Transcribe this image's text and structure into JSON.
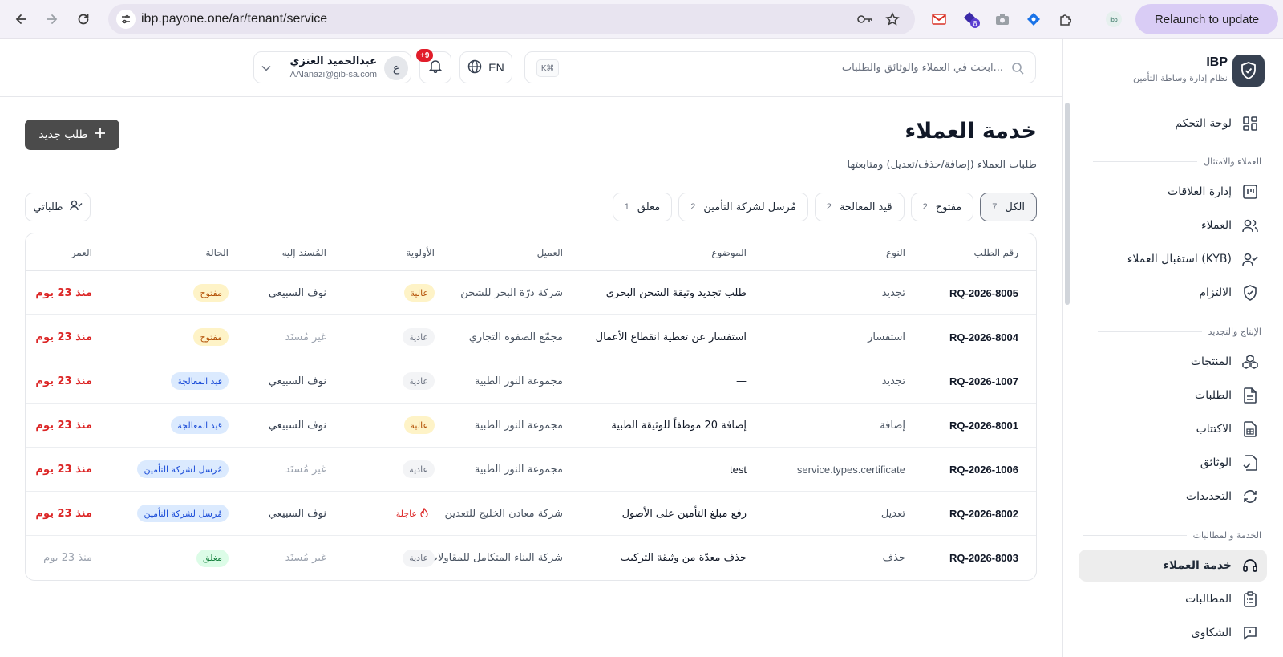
{
  "browser": {
    "url": "ibp.payone.one/ar/tenant/service",
    "relaunch_label": "Relaunch to update",
    "ext_badge": "8"
  },
  "brand": {
    "name": "IBP",
    "subtitle": "نظام إدارة وساطة التأمين"
  },
  "sidebar": {
    "dashboard": "لوحة التحكم",
    "section1": "العملاء والامتثال",
    "relations": "إدارة العلاقات",
    "clients": "العملاء",
    "kyb": "استقبال العملاء (KYB)",
    "compliance": "الالتزام",
    "section2": "الإنتاج والتجديد",
    "products": "المنتجات",
    "requests": "الطلبات",
    "underwriting": "الاكتتاب",
    "policies": "الوثائق",
    "renewals": "التجديدات",
    "section3": "الخدمة والمطالبات",
    "customer_service": "خدمة العملاء",
    "claims": "المطالبات",
    "complaints": "الشكاوى"
  },
  "header": {
    "search_placeholder": "ابحث في العملاء والوثائق والطلبات...",
    "search_kbd": "K⌘",
    "lang": "EN",
    "notif_badge": "+9",
    "user_name": "عبدالحميد العنزي",
    "user_email": "AAlanazi@gib-sa.com",
    "user_initial": "ع"
  },
  "main": {
    "title": "خدمة العملاء",
    "subtitle": "طلبات العملاء (إضافة/حذف/تعديل) ومتابعتها",
    "new_button": "طلب جديد",
    "mine_button": "طلباتي",
    "tabs": [
      {
        "label": "الكل",
        "count": "7"
      },
      {
        "label": "مفتوح",
        "count": "2"
      },
      {
        "label": "قيد المعالجة",
        "count": "2"
      },
      {
        "label": "مُرسل لشركة التأمين",
        "count": "2"
      },
      {
        "label": "مغلق",
        "count": "1"
      }
    ]
  },
  "table": {
    "headers": {
      "id": "رقم الطلب",
      "type": "النوع",
      "subject": "الموضوع",
      "client": "العميل",
      "priority": "الأولوية",
      "assignee": "المُسند إليه",
      "status": "الحالة",
      "age": "العمر"
    },
    "rows": [
      {
        "id": "RQ-2026-8005",
        "type": "تجديد",
        "subject": "طلب تجديد وثيقة الشحن البحري",
        "client": "شركة درّة البحر للشحن",
        "priority": "عالية",
        "assignee": "نوف السبيعي",
        "status": "مفتوح",
        "age": "منذ 23 يوم"
      },
      {
        "id": "RQ-2026-8004",
        "type": "استفسار",
        "subject": "استفسار عن تغطية انقطاع الأعمال",
        "client": "مجمّع الصفوة التجاري",
        "priority": "عادية",
        "assignee": "غير مُسنَد",
        "status": "مفتوح",
        "age": "منذ 23 يوم"
      },
      {
        "id": "RQ-2026-1007",
        "type": "تجديد",
        "subject": "—",
        "client": "مجموعة النور الطبية",
        "priority": "عادية",
        "assignee": "نوف السبيعي",
        "status": "قيد المعالجة",
        "age": "منذ 23 يوم"
      },
      {
        "id": "RQ-2026-8001",
        "type": "إضافة",
        "subject": "إضافة 20 موظفاً للوثيقة الطبية",
        "client": "مجموعة النور الطبية",
        "priority": "عالية",
        "assignee": "نوف السبيعي",
        "status": "قيد المعالجة",
        "age": "منذ 23 يوم"
      },
      {
        "id": "RQ-2026-1006",
        "type": "service.types.certificate",
        "subject": "test",
        "client": "مجموعة النور الطبية",
        "priority": "عادية",
        "assignee": "غير مُسنَد",
        "status": "مُرسل لشركة التأمين",
        "age": "منذ 23 يوم"
      },
      {
        "id": "RQ-2026-8002",
        "type": "تعديل",
        "subject": "رفع مبلغ التأمين على الأصول",
        "client": "شركة معادن الخليج للتعدين",
        "priority": "عاجلة",
        "assignee": "نوف السبيعي",
        "status": "مُرسل لشركة التأمين",
        "age": "منذ 23 يوم"
      },
      {
        "id": "RQ-2026-8003",
        "type": "حذف",
        "subject": "حذف معدّة من وثيقة التركيب",
        "client": "شركة البناء المتكامل للمقاولات",
        "priority": "عادية",
        "assignee": "غير مُسنَد",
        "status": "مغلق",
        "age": "منذ 23 يوم"
      }
    ]
  }
}
